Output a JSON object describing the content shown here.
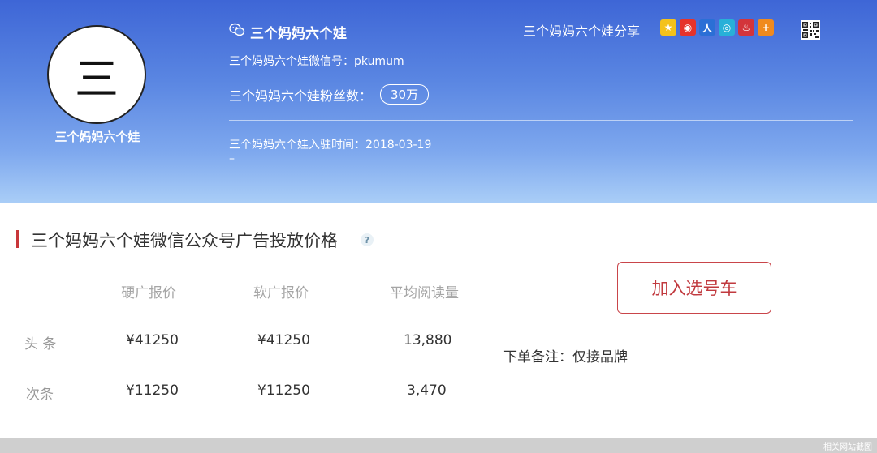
{
  "profile": {
    "avatar_char": "三",
    "name_under_avatar": "三个妈妈六个娃",
    "account_name": "三个妈妈六个娃",
    "wechat_id_line": "三个妈妈六个娃微信号：pkumum",
    "fans_label": "三个妈妈六个娃粉丝数：",
    "fans_value": "30万",
    "join_line": "三个妈妈六个娃入驻时间：2018-03-19",
    "dash": "–"
  },
  "share": {
    "label": "三个妈妈六个娃分享",
    "icons": [
      "qzone-icon",
      "weibo-icon",
      "renren-icon",
      "tencent-weibo-icon",
      "douban-icon",
      "more-share-icon",
      "qr-code-icon"
    ]
  },
  "pricing": {
    "title": "三个妈妈六个娃微信公众号广告投放价格",
    "help": "?",
    "headers": [
      "硬广报价",
      "软广报价",
      "平均阅读量"
    ],
    "rows": [
      {
        "label": "头 条",
        "hard": "¥41250",
        "soft": "¥41250",
        "reads": "13,880"
      },
      {
        "label": "次条",
        "hard": "¥11250",
        "soft": "¥11250",
        "reads": "3,470"
      }
    ],
    "cart_button": "加入选号车",
    "remark": "下单备注：仅接品牌"
  },
  "watermark": "相关网站截图",
  "colors": {
    "accent": "#c8363a",
    "hero_top": "#3e66d6",
    "hero_bottom": "#a9cdf7"
  }
}
